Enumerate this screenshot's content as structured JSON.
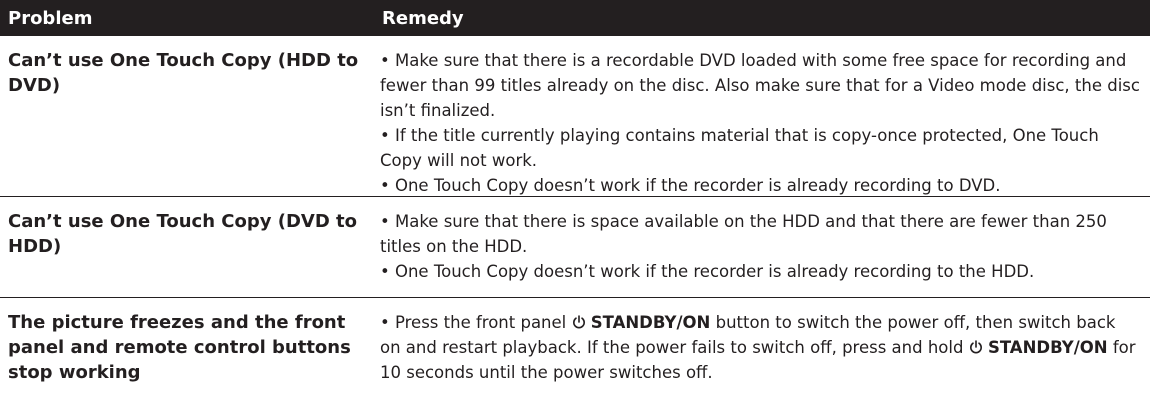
{
  "header": {
    "problem": "Problem",
    "remedy": "Remedy"
  },
  "rows": [
    {
      "problem": "Can’t use One Touch Copy (HDD to DVD)",
      "remedies": [
        "• Make sure that there is a recordable DVD loaded with some free space for recording and fewer than 99 titles already on the disc. Also make sure that for a Video mode disc, the disc isn’t finalized.",
        "• If the title currently playing contains material that is copy-once protected, One Touch Copy will not work.",
        "• One Touch Copy doesn’t work if the recorder is already recording to DVD."
      ]
    },
    {
      "problem": "Can’t use One Touch Copy (DVD to HDD)",
      "remedies": [
        "• Make sure that there is space available on the HDD and that there are fewer than 250 titles on the HDD.",
        "• One Touch Copy doesn’t work if the recorder is already recording to the HDD."
      ]
    },
    {
      "problem": "The picture freezes and the front panel and remote control buttons stop working",
      "remedy_parts": {
        "p1": "• Press the front panel ",
        "standby": "STANDBY/ON",
        "p2": " button to switch the power off, then switch back on and restart playback. If the power fails to switch off, press and hold ",
        "p3": " for 10 seconds until the power switches off."
      },
      "icon": "power-standby-icon"
    }
  ]
}
